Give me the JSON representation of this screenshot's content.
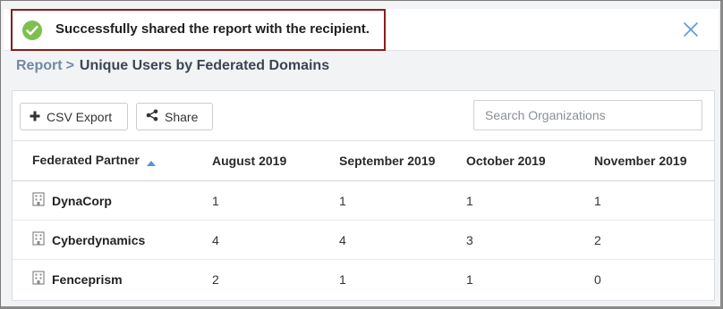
{
  "toast": {
    "message": "Successfully shared the report with the recipient.",
    "icon": "check-circle-icon",
    "close_icon": "close-icon"
  },
  "breadcrumb": {
    "root": "Report",
    "separator": ">",
    "title": "Unique Users by Federated Domains"
  },
  "toolbar": {
    "csv_label": "CSV Export",
    "share_label": "Share",
    "search_placeholder": "Search Organizations",
    "search_value": ""
  },
  "table": {
    "headers": [
      "Federated Partner",
      "August 2019",
      "September 2019",
      "October 2019",
      "November 2019"
    ],
    "sort": {
      "column": "Federated Partner",
      "direction": "ascending"
    },
    "rows": [
      {
        "name": "DynaCorp",
        "values": [
          "1",
          "1",
          "1",
          "1"
        ]
      },
      {
        "name": "Cyberdynamics",
        "values": [
          "4",
          "4",
          "3",
          "2"
        ]
      },
      {
        "name": "Fenceprism",
        "values": [
          "2",
          "1",
          "1",
          "0"
        ]
      }
    ]
  },
  "colors": {
    "success": "#7fbf4d",
    "highlight_border": "#8b1c1c",
    "breadcrumb_link": "#6f8aa6",
    "sort_arrow": "#5b8fd6"
  }
}
